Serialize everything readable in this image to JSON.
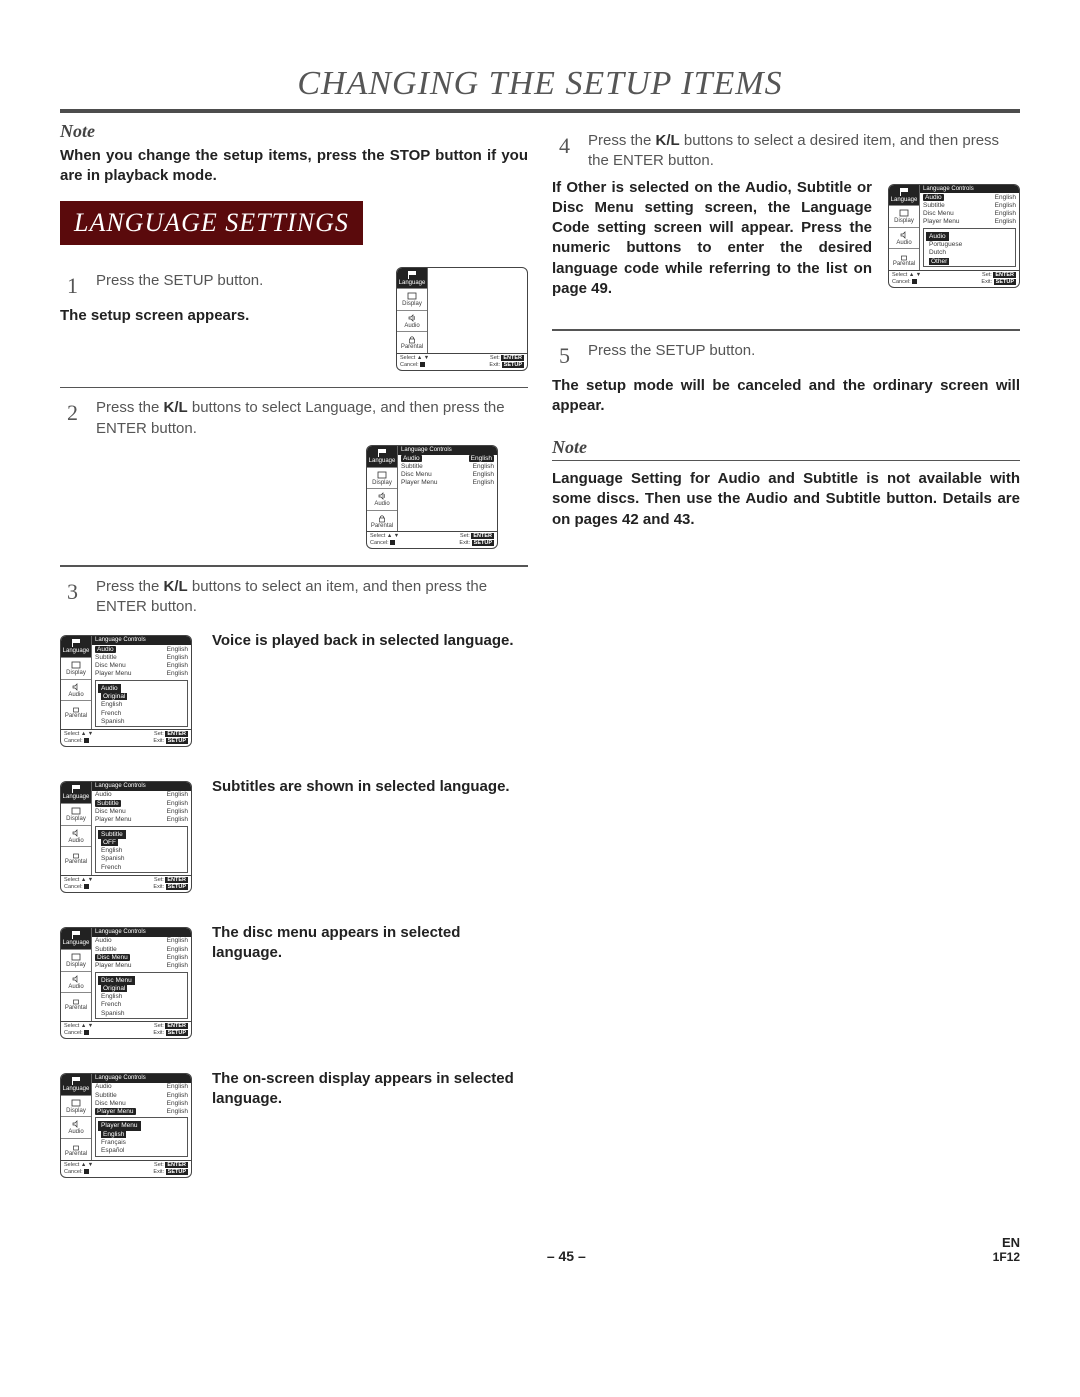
{
  "header": {
    "title": "CHANGING THE SETUP ITEMS"
  },
  "intro": {
    "note_label": "Note",
    "note_text": "When you change the setup items, press the STOP button if you are in playback mode."
  },
  "section": {
    "title": "LANGUAGE SETTINGS"
  },
  "left": {
    "step1_num": "1",
    "step1_text": "Press the SETUP button.",
    "step1_result": "The setup screen appears.",
    "step2_num": "2",
    "step2_text_a": "Press the ",
    "step2_kl": "K/L",
    "step2_text_b": " buttons to select Language, and then press the ENTER button.",
    "step3_num": "3",
    "step3_text_a": "Press the ",
    "step3_kl": "K/L",
    "step3_text_b": " buttons to select an item, and then press the ENTER button.",
    "desc_audio": "Voice is played back in selected language.",
    "desc_subtitle": "Subtitles are shown in selected language.",
    "desc_discmenu": "The disc menu appears in selected language.",
    "desc_playermenu": "The on-screen display appears in selected language."
  },
  "right": {
    "step4_num": "4",
    "step4_text_a": "Press the ",
    "step4_kl": "K/L",
    "step4_text_b": " buttons to select a desired item, and then press the ENTER button.",
    "other_text": "If Other is selected on the Audio, Subtitle or Disc Menu setting screen, the Language Code setting screen will appear. Press the numeric buttons to enter the desired language code while referring to the list on page 49.",
    "step5_num": "5",
    "step5_text": "Press the SETUP button.",
    "step5_result": "The setup mode will be canceled and the ordinary screen will appear.",
    "note2_label": "Note",
    "note2_text": "Language Setting for Audio and Subtitle is not available with some discs. Then use the Audio and Subtitle button. Details are on pages 42 and 43."
  },
  "osd": {
    "icons": {
      "language": "Language",
      "display": "Display",
      "audio": "Audio",
      "parental": "Parental"
    },
    "panel_title": "Language Controls",
    "rows": [
      {
        "l": "Audio",
        "r": "English"
      },
      {
        "l": "Subtitle",
        "r": "English"
      },
      {
        "l": "Disc Menu",
        "r": "English"
      },
      {
        "l": "Player Menu",
        "r": "English"
      }
    ],
    "audio_sub": {
      "title": "Audio",
      "opts": [
        "Original",
        "English",
        "French",
        "Spanish"
      ]
    },
    "subtitle_sub": {
      "title": "Subtitle",
      "opts": [
        "OFF",
        "English",
        "Spanish",
        "French"
      ]
    },
    "discmenu_sub": {
      "title": "Disc Menu",
      "opts": [
        "Original",
        "English",
        "French",
        "Spanish"
      ]
    },
    "playermenu_sub": {
      "title": "Player Menu",
      "opts": [
        "English",
        "Français",
        "Español"
      ]
    },
    "other_sub": {
      "title": "Audio",
      "opts": [
        "Portuguese",
        "Dutch",
        "Other"
      ]
    },
    "footer": {
      "select": "Select",
      "arrows": "▲ ▼",
      "set": "Set:",
      "enter": "ENTER",
      "cancel": "Cancel:",
      "exit": "Exit:",
      "setup": "SETUP"
    }
  },
  "footer": {
    "page": "– 45 –",
    "lang": "EN",
    "code": "1F12"
  }
}
